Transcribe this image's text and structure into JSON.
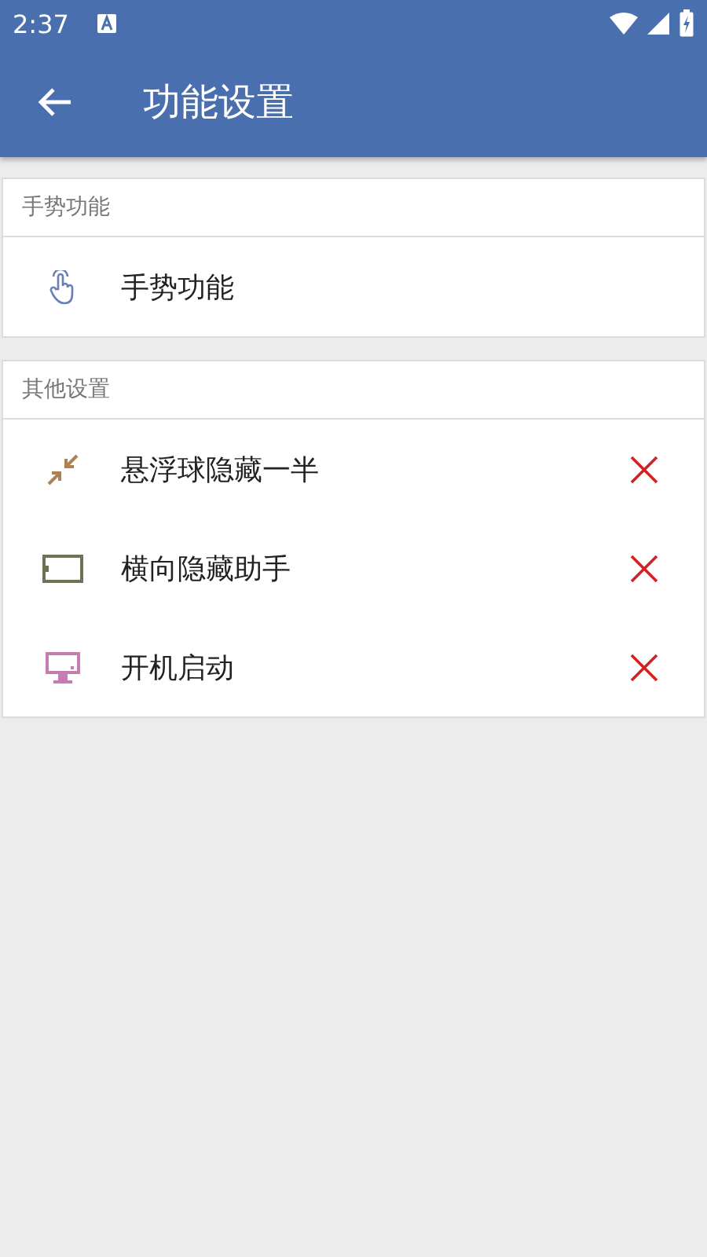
{
  "status_bar": {
    "time": "2:37"
  },
  "app_bar": {
    "title": "功能设置"
  },
  "sections": [
    {
      "header": "手势功能",
      "items": [
        {
          "kind": "gesture",
          "label": "手势功能"
        }
      ]
    },
    {
      "header": "其他设置",
      "items": [
        {
          "kind": "shrink",
          "label": "悬浮球隐藏一半",
          "on": false
        },
        {
          "kind": "landscape",
          "label": "横向隐藏助手",
          "on": false
        },
        {
          "kind": "monitor",
          "label": "开机启动",
          "on": false
        }
      ]
    }
  ]
}
